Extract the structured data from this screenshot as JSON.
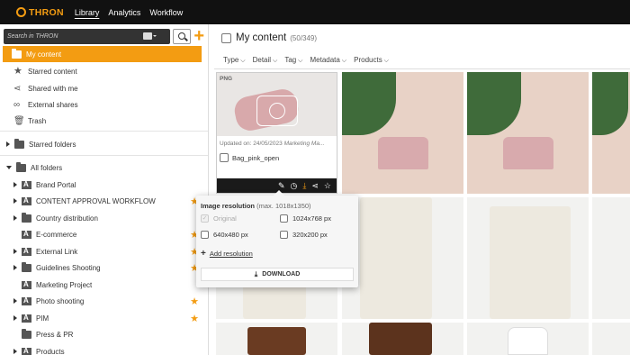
{
  "topbar": {
    "logo": "THRON",
    "nav": [
      "Library",
      "Analytics",
      "Workflow"
    ]
  },
  "sidebar": {
    "search_placeholder": "Search in THRON",
    "items": [
      {
        "label": "My content",
        "icon": "folder-icon"
      },
      {
        "label": "Starred content",
        "icon": "star-icon"
      },
      {
        "label": "Shared with me",
        "icon": "share-icon"
      },
      {
        "label": "External shares",
        "icon": "link-icon"
      },
      {
        "label": "Trash",
        "icon": "trash-icon"
      }
    ],
    "starred_folders": "Starred folders",
    "all_folders": "All folders",
    "folders": [
      "Brand Portal",
      "CONTENT APPROVAL WORKFLOW",
      "Country distribution",
      "E-commerce",
      "External Link",
      "Guidelines Shooting",
      "Marketing Project",
      "Photo shooting",
      "PIM",
      "Press & PR",
      "Products"
    ]
  },
  "main": {
    "title": "My content",
    "count": "(50/349)",
    "filters": [
      "Type",
      "Detail",
      "Tag",
      "Metadata",
      "Products"
    ],
    "card": {
      "type_badge": "PNG",
      "updated": "Updated on: 24/05/2023",
      "folder": "Marketing Ma...",
      "name": "Bag_pink_open"
    }
  },
  "popup": {
    "title": "Image resolution",
    "max": "(max. 1018x1350)",
    "options": [
      "Original",
      "1024x768 px",
      "640x480 px",
      "320x200 px"
    ],
    "add": "Add resolution",
    "download": "DOWNLOAD"
  },
  "colors": {
    "accent": "#f39c12",
    "topbar": "#111111"
  }
}
